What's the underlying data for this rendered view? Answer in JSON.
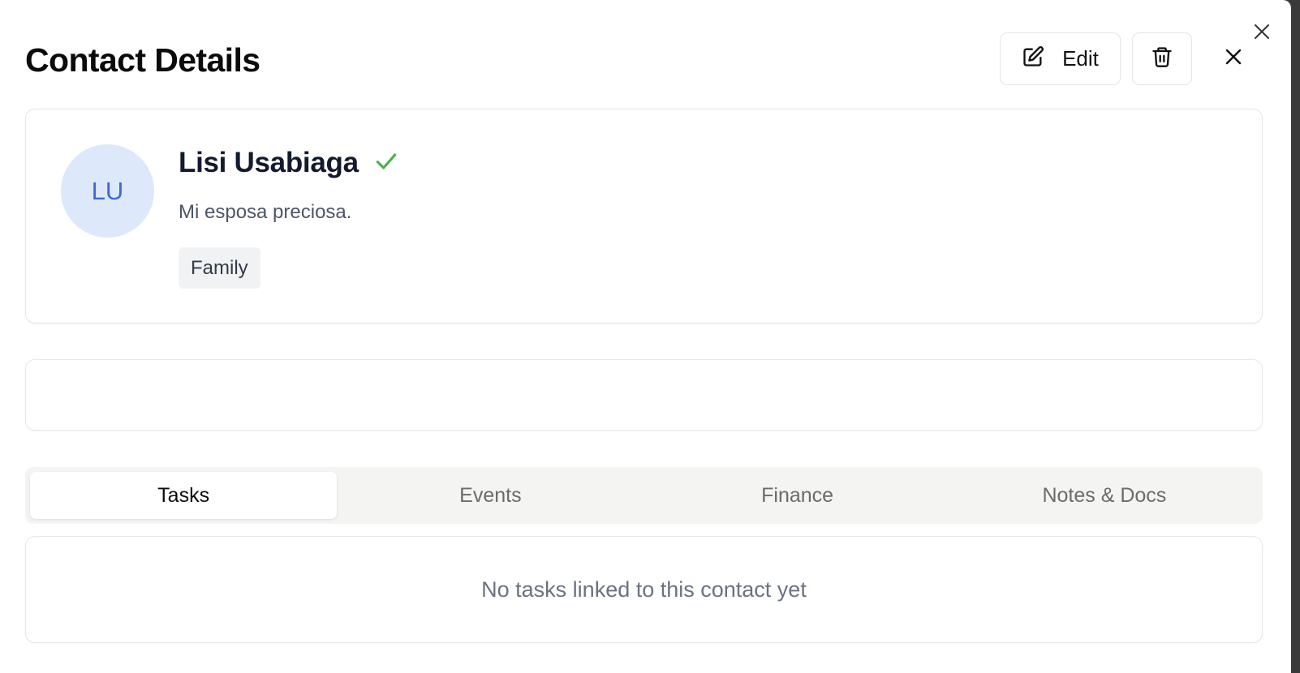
{
  "dialog": {
    "title": "Contact Details",
    "edit_label": "Edit"
  },
  "contact": {
    "initials": "LU",
    "name": "Lisi Usabiaga",
    "description": "Mi esposa preciosa.",
    "tag": "Family"
  },
  "tabs": [
    {
      "label": "Tasks",
      "active": true
    },
    {
      "label": "Events",
      "active": false
    },
    {
      "label": "Finance",
      "active": false
    },
    {
      "label": "Notes & Docs",
      "active": false
    }
  ],
  "tasks_panel": {
    "empty_message": "No tasks linked to this contact yet"
  },
  "icons": {
    "edit": "pencil-square-icon",
    "delete": "trash-icon",
    "close": "close-icon",
    "verified": "check-icon"
  },
  "colors": {
    "verified_check": "#4caf50",
    "avatar_bg": "#dde8fb",
    "avatar_text": "#3b6bd6"
  }
}
